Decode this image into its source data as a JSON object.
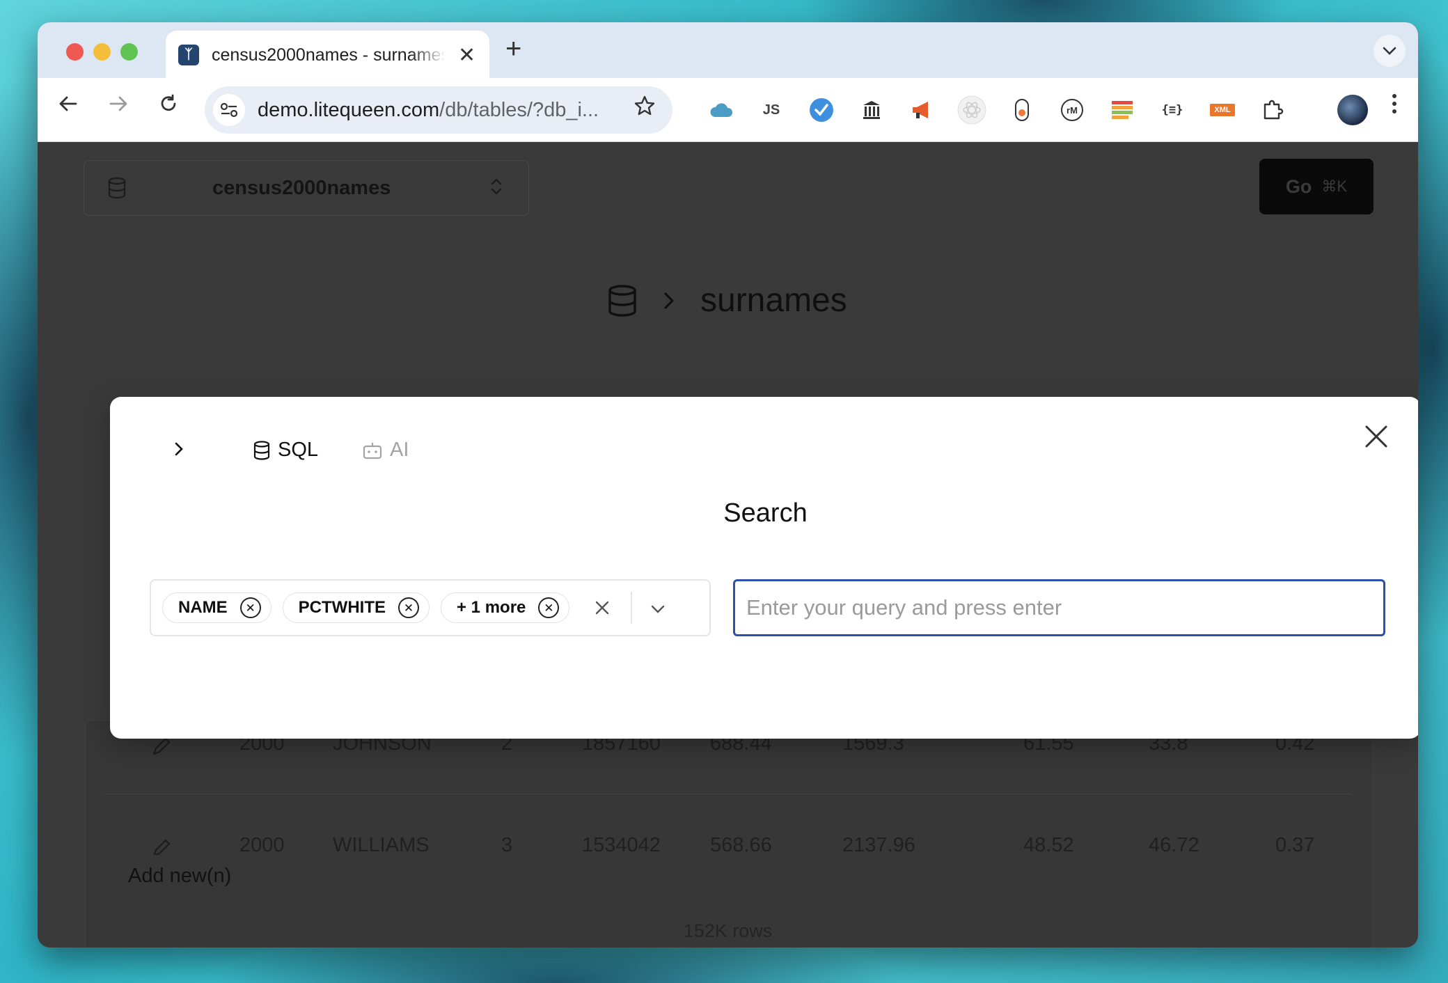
{
  "browser": {
    "tab_title": "census2000names - surnames",
    "tab_close": "✕",
    "new_tab": "+",
    "url_main": "demo.litequeen.com",
    "url_rest": "/db/tables/?db_i...",
    "extensions": [
      "cloud-icon",
      "js-icon",
      "checkmark-icon",
      "columns-icon",
      "megaphone-icon",
      "react-icon",
      "capsule-icon",
      "rm-icon",
      "stacked-bars-icon",
      "json-icon",
      "xml-icon",
      "puzzle-icon"
    ],
    "ext_labels": {
      "rm": "rM",
      "json": "{≡}",
      "xml": "XML",
      "js": "JS"
    }
  },
  "app": {
    "db_name": "census2000names",
    "go_label": "Go",
    "go_shortcut": "⌘K",
    "breadcrumb_table": "surnames",
    "rows": [
      {
        "year": "2000",
        "name": "JOHNSON",
        "rank": "2",
        "count": "1857160",
        "prop": "688.44",
        "cum": "1569.3",
        "white": "61.55",
        "black": "33.8",
        "api": "0.42"
      },
      {
        "year": "2000",
        "name": "WILLIAMS",
        "rank": "3",
        "count": "1534042",
        "prop": "568.66",
        "cum": "2137.96",
        "white": "48.52",
        "black": "46.72",
        "api": "0.37"
      }
    ],
    "add_new": "Add new(n)",
    "row_count": "152K rows"
  },
  "modal": {
    "tab_sql": "SQL",
    "tab_ai": "AI",
    "title": "Search",
    "chips": [
      "NAME",
      "PCTWHITE",
      "+ 1 more"
    ],
    "query_placeholder": "Enter your query and press enter",
    "query_value": ""
  },
  "colors": {
    "accent": "#2c4fa9",
    "modal_bg": "#ffffff",
    "app_bg": "#3a3a3a"
  }
}
